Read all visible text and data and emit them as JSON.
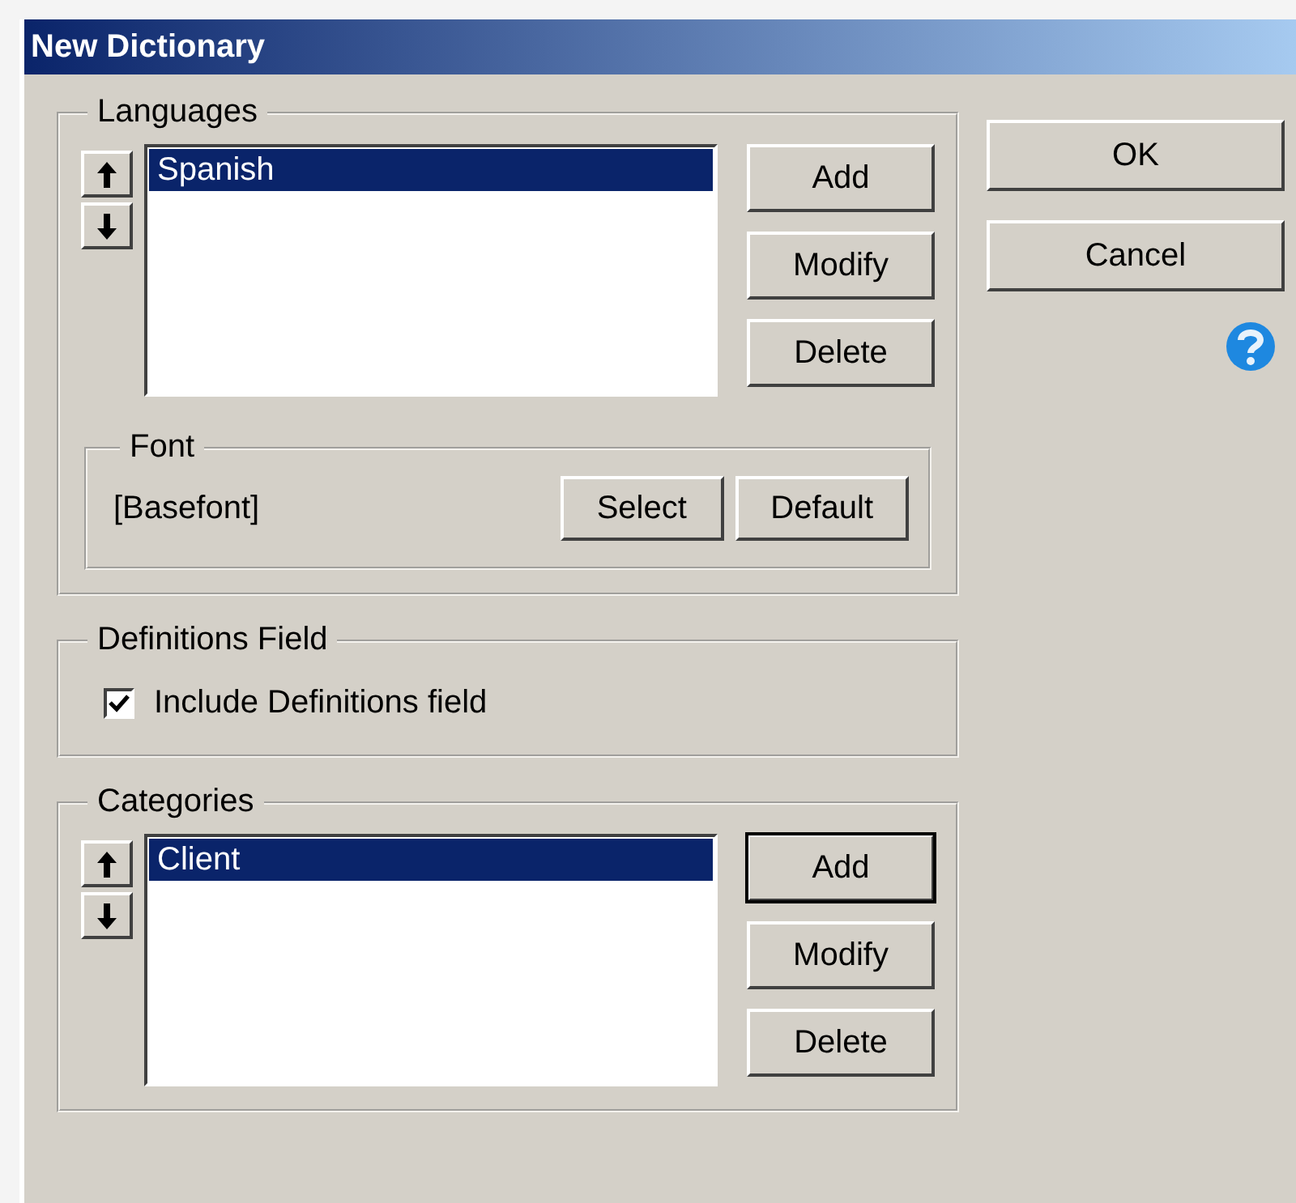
{
  "window": {
    "title": "New Dictionary"
  },
  "languages": {
    "label": "Languages",
    "items": [
      {
        "text": "Spanish",
        "selected": true
      }
    ],
    "buttons": [
      {
        "label": "Add",
        "default": false
      },
      {
        "label": "Modify",
        "default": false
      },
      {
        "label": "Delete",
        "default": false
      }
    ]
  },
  "font": {
    "label": "Font",
    "value": "[Basefont]",
    "buttons": [
      "Select",
      "Default"
    ]
  },
  "definitions": {
    "label": "Definitions Field",
    "checkbox": {
      "label": "Include Definitions field",
      "checked": true
    }
  },
  "categories": {
    "label": "Categories",
    "items": [
      {
        "text": "Client",
        "selected": true
      }
    ],
    "buttons": [
      {
        "label": "Add",
        "default": true
      },
      {
        "label": "Modify",
        "default": false
      },
      {
        "label": "Delete",
        "default": false
      }
    ]
  },
  "dialog_buttons": [
    "OK",
    "Cancel"
  ]
}
